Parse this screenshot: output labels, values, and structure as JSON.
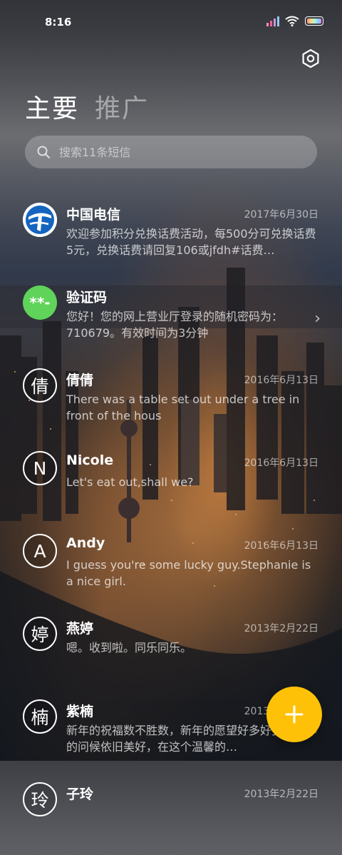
{
  "status_bar": {
    "time": "8:16",
    "icons": [
      "signal-icon",
      "wifi-icon",
      "battery-icon"
    ]
  },
  "header": {
    "settings_icon": "gear-icon"
  },
  "tabs": [
    {
      "label": "主要",
      "active": true
    },
    {
      "label": "推广",
      "active": false
    }
  ],
  "search": {
    "placeholder": "搜索11条短信",
    "icon": "search-icon"
  },
  "conversations": [
    {
      "name": "中国电信",
      "date": "2017年6月30日",
      "preview": "欢迎参加积分兑换话费活动，每500分可兑换话费5元，兑换话费请回复106或jfdh#话费…",
      "avatar": {
        "type": "logo",
        "icon": "china-telecom-logo"
      }
    },
    {
      "name": "验证码",
      "date": "",
      "preview": "您好！您的网上营业厅登录的随机密码为：710679。有效时间为3分钟",
      "avatar": {
        "type": "badge",
        "text": "**-",
        "color": "#5fd35a"
      },
      "has_chevron": true
    },
    {
      "name": "倩倩",
      "date": "2016年6月13日",
      "preview": "There was a table set out under a tree in front of the hous",
      "avatar": {
        "type": "letter",
        "text": "倩"
      }
    },
    {
      "name": "Nicole",
      "date": "2016年6月13日",
      "preview": "Let's eat out,shall we?",
      "avatar": {
        "type": "letter",
        "text": "N"
      }
    },
    {
      "name": "Andy",
      "date": "2016年6月13日",
      "preview": "I guess you're some lucky guy.Stephanie is a nice girl.",
      "avatar": {
        "type": "letter",
        "text": "A"
      }
    },
    {
      "name": "燕婷",
      "date": "2013年2月22日",
      "preview": "嗯。收到啦。同乐同乐。",
      "avatar": {
        "type": "letter",
        "text": "婷"
      }
    },
    {
      "name": "紫楠",
      "date": "2013年2月22日",
      "preview": "新年的祝福数不胜数，新年的愿望好多好多，新年的问候依旧美好，在这个温馨的…",
      "avatar": {
        "type": "letter",
        "text": "楠"
      }
    },
    {
      "name": "子玲",
      "date": "2013年2月22日",
      "preview": "",
      "avatar": {
        "type": "letter",
        "text": "玲"
      }
    }
  ],
  "fab": {
    "icon": "plus-icon",
    "color": "#ffc107"
  }
}
